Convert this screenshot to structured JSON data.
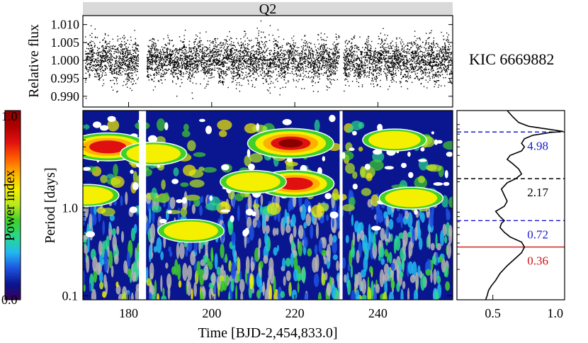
{
  "figure": {
    "quarter_label": "Q2",
    "star_label": "KIC 6669882",
    "colors": {
      "quarter_bar": "#d9d9d9",
      "flux_points": "#000000",
      "contour_white": "#ffffff",
      "contour_gray": "#b5b5b5",
      "gap": "#ffffff",
      "blue_line": "#1a1acc",
      "black_line": "#000000",
      "red_line": "#cc1111"
    },
    "colorbar": {
      "label": "Power index",
      "min_label": "0.0",
      "max_label": "1.0",
      "mid_label": "1.0",
      "colors": [
        "#3a0059",
        "#0a1590",
        "#1d54e0",
        "#22b8f0",
        "#29d98a",
        "#3fd02a",
        "#b8e820",
        "#f5f000",
        "#ffb000",
        "#ff5a00",
        "#e01010",
        "#b00000",
        "#8a0000"
      ]
    }
  },
  "chart_data": [
    {
      "id": "light_curve",
      "type": "scatter",
      "title": "Q2",
      "xlabel": "",
      "ylabel": "Relative flux",
      "xlim": [
        169,
        258
      ],
      "ylim": [
        0.987,
        1.0125
      ],
      "yticks": [
        "1.010",
        "1.005",
        "1.000",
        "0.995",
        "0.990"
      ],
      "ytick_values": [
        1.01,
        1.005,
        1.0,
        0.995,
        0.99
      ],
      "data_gaps": [
        [
          182.5,
          184.2
        ],
        [
          230.8,
          231.5
        ]
      ],
      "segments": [
        [
          169.5,
          182.3
        ],
        [
          184.3,
          230.6
        ],
        [
          231.6,
          257.8
        ]
      ],
      "flux_mean": 1.0,
      "flux_scatter": 0.0035,
      "annotation": "KIC 6669882"
    },
    {
      "id": "wavelet_power",
      "type": "heatmap",
      "xlabel": "Time [BJD-2,454,833.0]",
      "ylabel": "Period [days]",
      "xlim": [
        169,
        258
      ],
      "ylog": true,
      "ylim": [
        0.09,
        13
      ],
      "xticks": [
        180,
        200,
        220,
        240
      ],
      "yticks": [
        "0.1",
        "1.0"
      ],
      "ytick_values": [
        0.1,
        1.0
      ],
      "data_gaps": [
        [
          182.5,
          184.2
        ],
        [
          230.8,
          231.5
        ]
      ],
      "colorbar_label": "Power index",
      "colorbar_range": [
        0.0,
        1.0
      ],
      "high_power_regions": [
        {
          "time": 175,
          "period": 5.0,
          "power": 0.9
        },
        {
          "time": 219,
          "period": 5.5,
          "power": 1.0
        },
        {
          "time": 220,
          "period": 1.9,
          "power": 0.85
        },
        {
          "time": 244,
          "period": 6.0,
          "power": 0.55
        },
        {
          "time": 186,
          "period": 4.2,
          "power": 0.6
        },
        {
          "time": 210,
          "period": 2.0,
          "power": 0.6
        },
        {
          "time": 248,
          "period": 1.3,
          "power": 0.55
        },
        {
          "time": 170,
          "period": 1.4,
          "power": 0.55
        },
        {
          "time": 195,
          "period": 0.55,
          "power": 0.6
        }
      ]
    },
    {
      "id": "global_wavelet",
      "type": "line",
      "xlabel": "",
      "ylabel": "",
      "xlim": [
        0.25,
        1.0
      ],
      "ylog": true,
      "ylim": [
        0.09,
        13
      ],
      "xticks": [
        "0.5",
        "1.0"
      ],
      "xtick_values": [
        0.5,
        1.0
      ],
      "series": [
        {
          "x": [
            0.45,
            0.46,
            0.47,
            0.49,
            0.52,
            0.55,
            0.6,
            0.66,
            0.7,
            0.72,
            0.7,
            0.62,
            0.58,
            0.55,
            0.56,
            0.58,
            0.55,
            0.52,
            0.58,
            0.6,
            0.58,
            0.56,
            0.6,
            0.66,
            0.7,
            0.68,
            0.64,
            0.6,
            0.62,
            0.7,
            0.72,
            0.7,
            0.72,
            0.78,
            0.9,
            0.99,
            0.9,
            0.75,
            0.68,
            0.64,
            0.6
          ],
          "y": [
            0.09,
            0.1,
            0.115,
            0.13,
            0.15,
            0.18,
            0.22,
            0.27,
            0.31,
            0.36,
            0.41,
            0.47,
            0.53,
            0.6,
            0.67,
            0.72,
            0.8,
            0.92,
            1.05,
            1.2,
            1.4,
            1.65,
            1.95,
            2.17,
            2.45,
            2.8,
            3.2,
            3.6,
            4.0,
            4.5,
            5.0,
            5.5,
            6.2,
            6.8,
            7.3,
            7.5,
            7.9,
            8.6,
            9.5,
            11.0,
            13.0
          ]
        }
      ],
      "period_markers": [
        {
          "label": "4.98",
          "period": 7.4,
          "style": "dashed",
          "color": "blue"
        },
        {
          "label": "2.17",
          "period": 2.17,
          "style": "dashed",
          "color": "black"
        },
        {
          "label": "0.72",
          "period": 0.72,
          "style": "dashed",
          "color": "blue"
        },
        {
          "label": "0.36",
          "period": 0.36,
          "style": "solid",
          "color": "red"
        }
      ]
    }
  ]
}
